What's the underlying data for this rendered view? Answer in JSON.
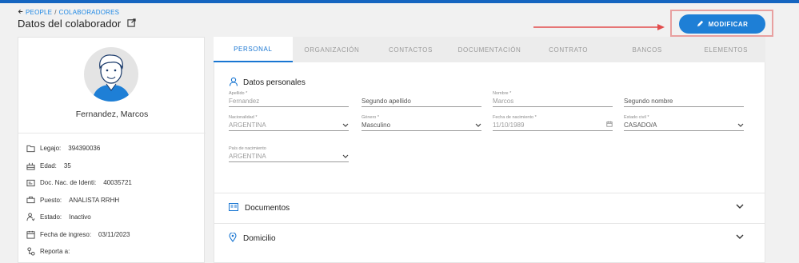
{
  "breadcrumb": {
    "back_icon": "arrow-left-icon",
    "parent": "PEOPLE",
    "separator": "/",
    "current": "COLABORADORES"
  },
  "page": {
    "title": "Datos del colaborador",
    "title_icon": "open-external-icon"
  },
  "actions": {
    "modify_label": "MODIFICAR",
    "modify_icon": "pencil-icon",
    "highlight_color": "#e8a0a0",
    "accent": "#1e7fd6"
  },
  "profile": {
    "name": "Fernandez, Marcos",
    "items": [
      {
        "icon": "folder-icon",
        "label": "Legajo:",
        "value": "394390036"
      },
      {
        "icon": "cake-icon",
        "label": "Edad:",
        "value": "35"
      },
      {
        "icon": "id-card-icon",
        "label": "Doc. Nac. de Identi:",
        "value": "40035721"
      },
      {
        "icon": "briefcase-icon",
        "label": "Puesto:",
        "value": "ANALISTA RRHH"
      },
      {
        "icon": "person-status-icon",
        "label": "Estado:",
        "value": "Inactivo"
      },
      {
        "icon": "calendar-icon",
        "label": "Fecha de ingreso:",
        "value": "03/11/2023"
      },
      {
        "icon": "org-chart-icon",
        "label": "Reporta a:",
        "value": ""
      }
    ]
  },
  "tabs": [
    "PERSONAL",
    "ORGANIZACIÓN",
    "CONTACTOS",
    "DOCUMENTACIÓN",
    "CONTRATO",
    "BANCOS",
    "ELEMENTOS"
  ],
  "personal": {
    "section_title": "Datos personales",
    "fields": {
      "apellido": {
        "label": "Apellido *",
        "value": "Fernandez"
      },
      "segundo_apellido": {
        "placeholder": "Segundo apellido"
      },
      "nombre": {
        "label": "Nombre *",
        "value": "Marcos"
      },
      "segundo_nombre": {
        "placeholder": "Segundo nombre"
      },
      "nacionalidad": {
        "label": "Nacionalidad *",
        "value": "ARGENTINA"
      },
      "genero": {
        "label": "Género *",
        "value": "Masculino"
      },
      "fecha_nacimiento": {
        "label": "Fecha de nacimiento *",
        "value": "11/10/1989"
      },
      "estado_civil": {
        "label": "Estado civil *",
        "value": "CASADO/A"
      },
      "pais_nacimiento": {
        "label": "País de nacimiento",
        "value": "ARGENTINA"
      }
    }
  },
  "accordions": {
    "documentos": {
      "title": "Documentos",
      "icon": "document-card-icon"
    },
    "domicilio": {
      "title": "Domicilio",
      "icon": "location-pin-icon"
    }
  }
}
